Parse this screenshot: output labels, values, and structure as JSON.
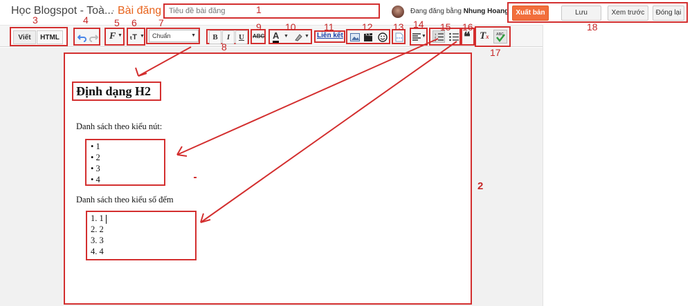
{
  "header": {
    "blog_title": "Học Blogspot - Toà...",
    "separator": "·",
    "page_label": "Bài đăng",
    "title_placeholder": "Tiêu đề bài đăng",
    "status_text": "Đang đăng bằng",
    "author": "Nhung Hoang",
    "buttons": {
      "publish": "Xuất bản",
      "save": "Lưu",
      "preview": "Xem trước",
      "close": "Đóng lại"
    }
  },
  "toolbar": {
    "mode_write": "Viết",
    "mode_html": "HTML",
    "format_value": "Chuẩn",
    "bold": "B",
    "italic": "I",
    "underline": "U",
    "spell": "ABC",
    "link": "Liên kết",
    "icons": [
      "undo-icon",
      "redo-icon",
      "font-icon",
      "font-size-icon",
      "text-color-icon",
      "highlight-icon",
      "image-icon",
      "video-icon",
      "emoji-icon",
      "jump-break-icon",
      "align-icon",
      "numbered-list-icon",
      "bullet-list-icon",
      "quote-icon",
      "clear-format-icon",
      "spellcheck-icon"
    ]
  },
  "editor": {
    "heading": "Định dạng H2",
    "bullet_caption": "Danh sách theo kiểu nút:",
    "bullet_items": [
      "1",
      "2",
      "3",
      "4"
    ],
    "ordered_caption": "Danh sách theo kiểu số đếm",
    "ordered_items": [
      "1. 1",
      "2. 2",
      "3. 3",
      "4. 4"
    ]
  },
  "annotations": {
    "n1": "1",
    "n2": "2",
    "n3": "3",
    "n4": "4",
    "n5": "5",
    "n6": "6",
    "n7": "7",
    "n8": "8",
    "n9": "9",
    "n10": "10",
    "n11": "11",
    "n12": "12",
    "n13": "13",
    "n14": "14",
    "n15": "15",
    "n16": "16",
    "n17": "17",
    "n18": "18"
  },
  "colors": {
    "accent": "#f26f3c",
    "annotation": "#d32f2f",
    "link": "#1a3fa8"
  }
}
